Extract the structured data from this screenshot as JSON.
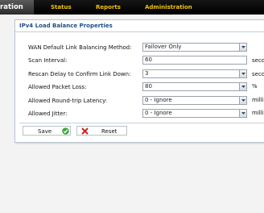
{
  "nav": {
    "active_tab": "uration",
    "links": [
      "Status",
      "Reports",
      "Administration"
    ]
  },
  "panel": {
    "title": "IPv4 Load Balance Properties"
  },
  "form": {
    "rows": [
      {
        "label": "WAN Default Link Balancing Method:",
        "value": "Failover Only",
        "type": "select",
        "unit": ""
      },
      {
        "label": "Scan Interval:",
        "value": "60",
        "type": "text",
        "unit": "seco"
      },
      {
        "label": "Rescan Delay to Confirm Link Down:",
        "value": "3",
        "type": "select",
        "unit": "seco"
      },
      {
        "label": "Allowed Packet Loss:",
        "value": "80",
        "type": "select",
        "unit": "%"
      },
      {
        "label": "Allowed Round-trip Latency:",
        "value": "0 - Ignore",
        "type": "select",
        "unit": "milli s"
      },
      {
        "label": "Allowed Jitter:",
        "value": "0 - Ignore",
        "type": "select",
        "unit": "milli s"
      }
    ]
  },
  "buttons": {
    "save_label": "Save",
    "reset_label": "Reset"
  },
  "colors": {
    "nav_link": "#f2c400",
    "panel_title": "#1e4f8a",
    "save_icon": "#3aa83a",
    "reset_icon": "#d0201a"
  }
}
